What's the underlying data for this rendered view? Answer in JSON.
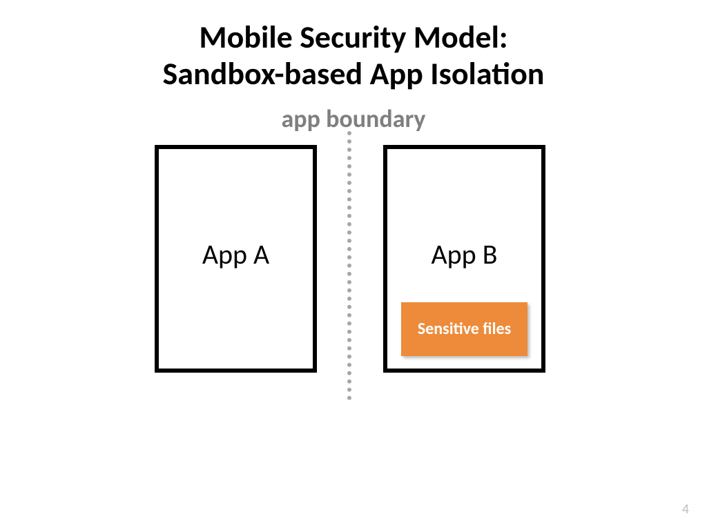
{
  "title_line1": "Mobile Security Model:",
  "title_line2": "Sandbox-based App Isolation",
  "boundary_label": "app boundary",
  "app_a_label": "App A",
  "app_b_label": "App B",
  "sensitive_label": "Sensitive files",
  "page_number": "4",
  "colors": {
    "accent_orange": "#ed8b3a",
    "gray_text": "#7f7f7f",
    "divider_gray": "#a6a6a6",
    "page_num_gray": "#bfbfbf"
  }
}
